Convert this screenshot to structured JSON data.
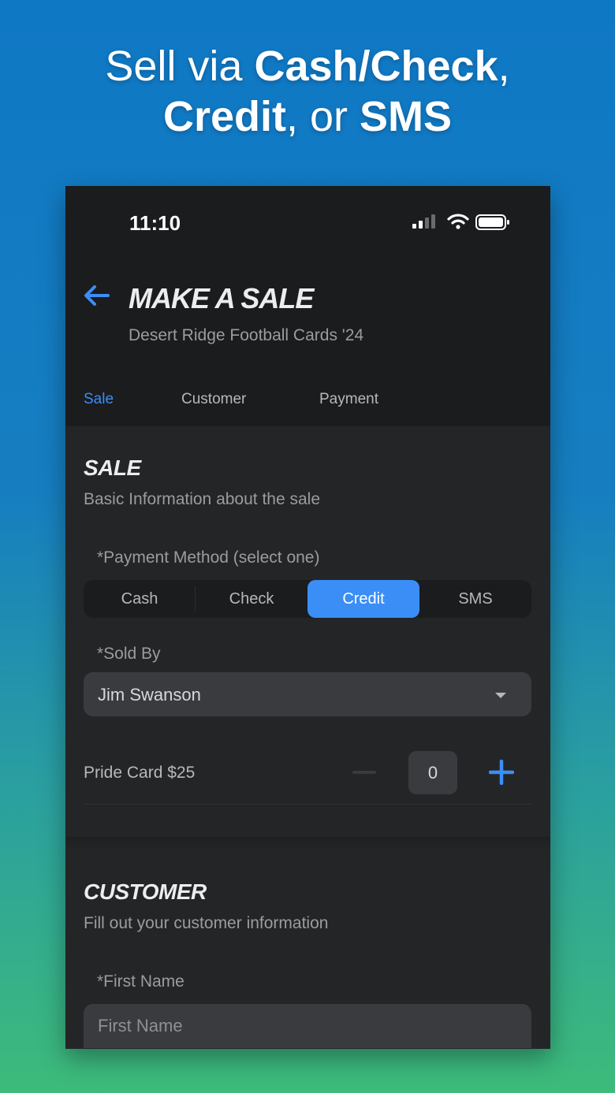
{
  "headline": {
    "line1_a": "Sell via ",
    "line1_b": "Cash/Check",
    "line1_c": ",",
    "line2_a": "Credit",
    "line2_b": ", or ",
    "line2_c": "SMS"
  },
  "status_bar": {
    "time": "11:10"
  },
  "header": {
    "title": "MAKE A SALE",
    "subtitle": "Desert Ridge Football Cards '24"
  },
  "tabs": [
    {
      "label": "Sale",
      "active": true
    },
    {
      "label": "Customer",
      "active": false
    },
    {
      "label": "Payment",
      "active": false
    }
  ],
  "sale_section": {
    "title": "SALE",
    "subtitle": "Basic Information about the sale",
    "payment_label": "*Payment Method (select one)",
    "payment_options": [
      "Cash",
      "Check",
      "Credit",
      "SMS"
    ],
    "payment_selected": "Credit",
    "sold_by_label": "*Sold By",
    "sold_by_value": "Jim Swanson",
    "product_label": "Pride Card $25",
    "quantity": "0"
  },
  "customer_section": {
    "title": "CUSTOMER",
    "subtitle": "Fill out your customer information",
    "first_name_label": "*First Name",
    "first_name_placeholder": "First Name"
  },
  "colors": {
    "accent": "#3b8ef5",
    "background": "#242527",
    "header_bg": "#1b1c1e"
  }
}
